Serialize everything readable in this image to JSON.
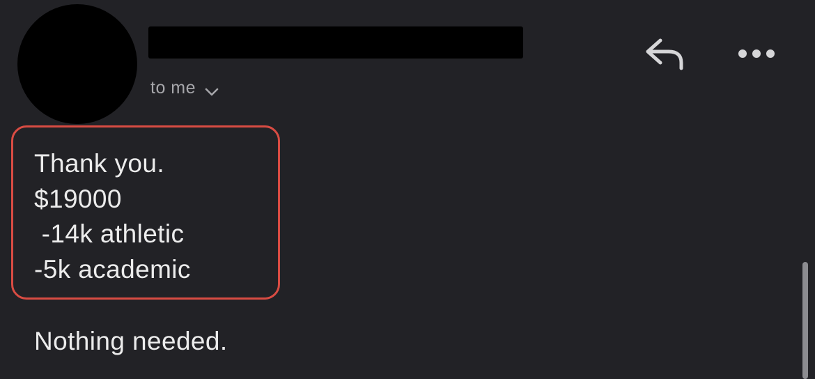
{
  "header": {
    "recipient_label": "to me",
    "icons": {
      "expand": "chevron-down-icon",
      "reply": "reply-icon",
      "more": "more-horizontal-icon"
    }
  },
  "message": {
    "highlighted_lines": [
      "Thank you.",
      "$19000",
      " -14k athletic",
      "-5k academic"
    ],
    "footer_line": "Nothing needed."
  },
  "colors": {
    "background": "#222226",
    "highlight_border": "#d94c43",
    "secondary_text": "#a6a6aa"
  }
}
